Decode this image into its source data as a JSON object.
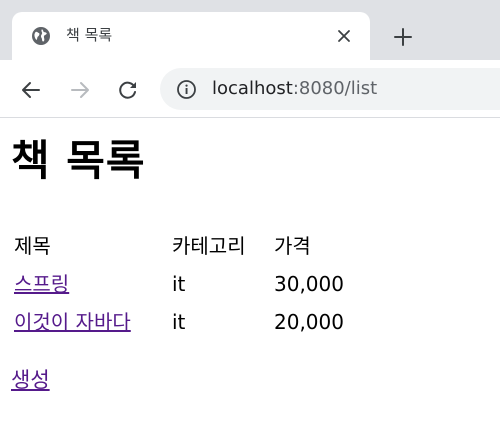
{
  "browser": {
    "tab_title": "책 목록",
    "url_host": "localhost",
    "url_rest": ":8080/list",
    "icons": [
      "globe-icon",
      "close-icon",
      "plus-icon",
      "back-arrow-icon",
      "forward-arrow-icon",
      "reload-icon",
      "info-icon"
    ]
  },
  "page": {
    "heading": "책 목록",
    "table": {
      "headers": [
        "제목",
        "카테고리",
        "가격"
      ],
      "rows": [
        [
          "스프링",
          "it",
          "30,000"
        ],
        [
          "이것이 자바다",
          "it",
          "20,000"
        ]
      ]
    },
    "create_link": "생성"
  },
  "colors": {
    "visited_link": "#551a8b",
    "tabstrip_bg": "#dfe1e5",
    "omnibox_bg": "#f1f3f4"
  }
}
